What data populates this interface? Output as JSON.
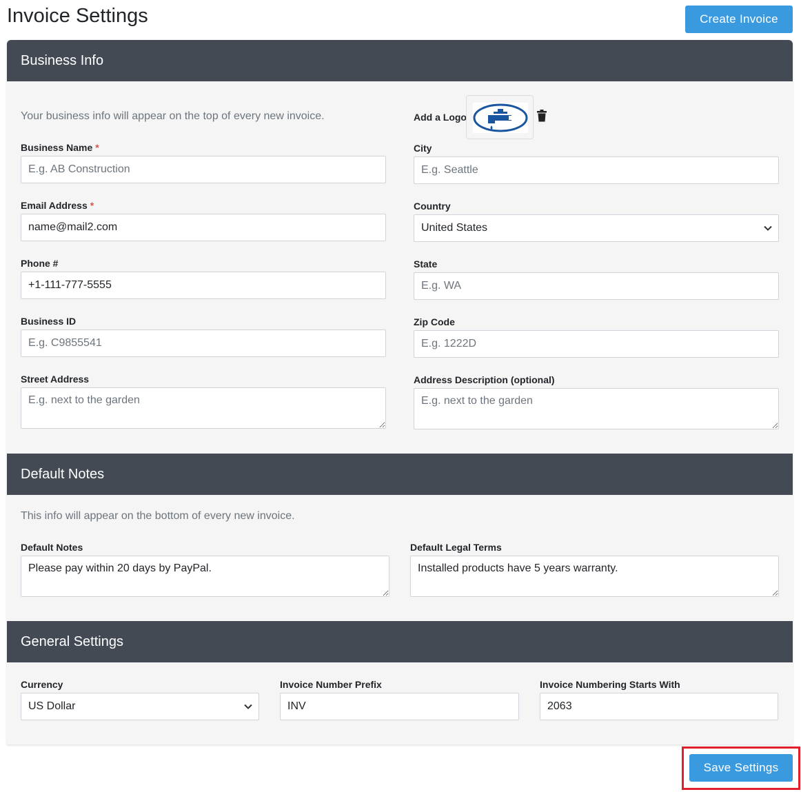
{
  "header": {
    "title": "Invoice Settings",
    "create_label": "Create Invoice"
  },
  "business": {
    "section_title": "Business Info",
    "description": "Your business info will appear on the top of every new invoice.",
    "logo_label": "Add a Logo",
    "name": {
      "label": "Business Name",
      "required": "*",
      "placeholder": "E.g. AB Construction",
      "value": ""
    },
    "email": {
      "label": "Email Address",
      "required": "*",
      "placeholder": "",
      "value": "name@mail2.com"
    },
    "phone": {
      "label": "Phone #",
      "placeholder": "",
      "value": "+1-111-777-5555"
    },
    "business_id": {
      "label": "Business ID",
      "placeholder": "E.g. C9855541",
      "value": ""
    },
    "street": {
      "label": "Street Address",
      "placeholder": "E.g. next to the garden",
      "value": ""
    },
    "city": {
      "label": "City",
      "placeholder": "E.g. Seattle",
      "value": ""
    },
    "country": {
      "label": "Country",
      "value": "United States"
    },
    "state": {
      "label": "State",
      "placeholder": "E.g. WA",
      "value": ""
    },
    "zip": {
      "label": "Zip Code",
      "placeholder": "E.g. 1222D",
      "value": ""
    },
    "address_desc": {
      "label": "Address Description (optional)",
      "placeholder": "E.g. next to the garden",
      "value": ""
    }
  },
  "notes": {
    "section_title": "Default Notes",
    "description": "This info will appear on the bottom of every new invoice.",
    "default_notes": {
      "label": "Default Notes",
      "value": "Please pay within 20 days by PayPal."
    },
    "legal_terms": {
      "label": "Default Legal Terms",
      "value": "Installed products have 5 years warranty."
    }
  },
  "general": {
    "section_title": "General Settings",
    "currency": {
      "label": "Currency",
      "value": "US Dollar"
    },
    "prefix": {
      "label": "Invoice Number Prefix",
      "value": "INV"
    },
    "start": {
      "label": "Invoice Numbering Starts With",
      "value": "2063"
    }
  },
  "footer": {
    "save_label": "Save Settings"
  },
  "colors": {
    "primary": "#3a9ae0",
    "header_bg": "#434a54",
    "highlight": "#e0202a",
    "logo_blue": "#1a56a0"
  }
}
